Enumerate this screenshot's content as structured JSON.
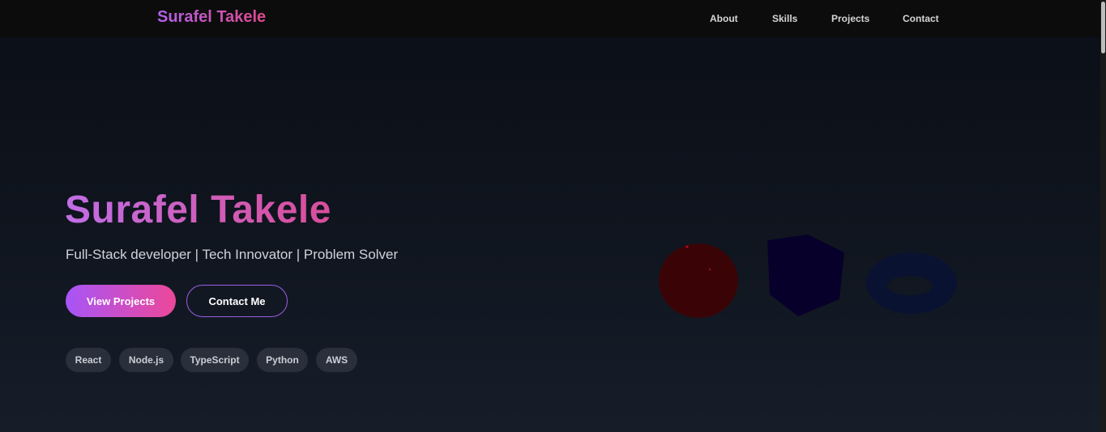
{
  "nav": {
    "brand": "Surafel Takele",
    "links": [
      "About",
      "Skills",
      "Projects",
      "Contact"
    ]
  },
  "hero": {
    "title": "Surafel Takele",
    "subtitle": "Full-Stack developer | Tech Innovator | Problem Solver",
    "primary_button": "View Projects",
    "secondary_button": "Contact Me",
    "tags": [
      "React",
      "Node.js",
      "TypeScript",
      "Python",
      "AWS"
    ]
  },
  "shapes": {
    "sphere_color": "#3a0407",
    "cube_color": "#07002a",
    "torus_color": "#0a1232"
  },
  "colors": {
    "accent_start": "#a855f7",
    "accent_end": "#ec4899",
    "nav_bg": "#0c0c0c",
    "tag_bg": "#2a303b"
  }
}
